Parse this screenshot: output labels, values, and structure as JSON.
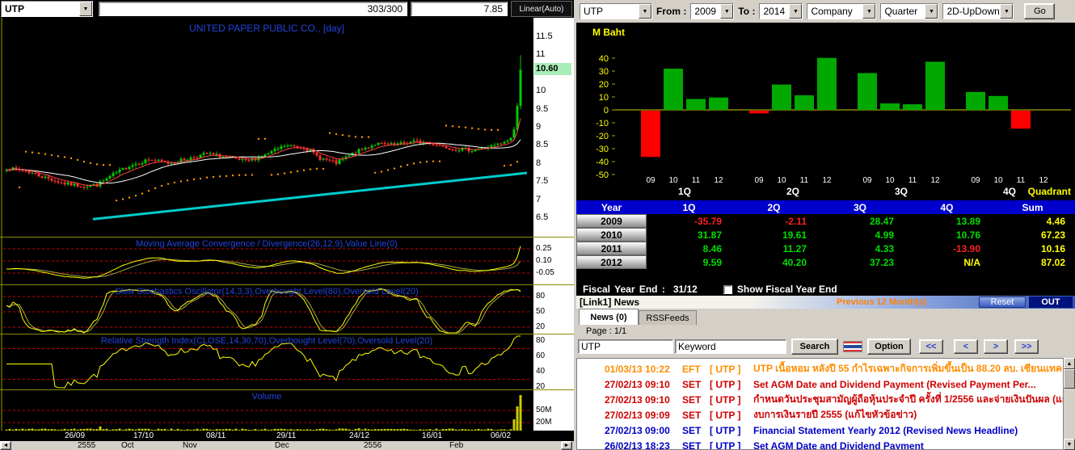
{
  "left": {
    "toolbar": {
      "symbol": "UTP",
      "range_field": "303/300",
      "price_field": "7.85",
      "scale_button": "Linear(Auto)"
    },
    "chart": {
      "title": "UNITED PAPER PUBLIC CO., [day]",
      "last_price": "10.60",
      "price_axis": [
        "11.5",
        "11",
        "10",
        "9.5",
        "9",
        "8.5",
        "8",
        "7.5",
        "7",
        "6.5"
      ],
      "candle_count": 160,
      "price_anchors": [
        [
          0,
          7.88
        ],
        [
          6,
          7.8
        ],
        [
          12,
          7.62
        ],
        [
          18,
          7.45
        ],
        [
          24,
          7.38
        ],
        [
          28,
          7.42
        ],
        [
          33,
          7.7
        ],
        [
          38,
          7.95
        ],
        [
          44,
          8.12
        ],
        [
          50,
          8.02
        ],
        [
          56,
          8.14
        ],
        [
          62,
          8.28
        ],
        [
          68,
          8.18
        ],
        [
          74,
          8.06
        ],
        [
          80,
          8.24
        ],
        [
          86,
          8.5
        ],
        [
          92,
          8.46
        ],
        [
          97,
          8.16
        ],
        [
          102,
          8.02
        ],
        [
          108,
          8.32
        ],
        [
          114,
          8.55
        ],
        [
          120,
          8.52
        ],
        [
          126,
          8.62
        ],
        [
          132,
          8.55
        ],
        [
          138,
          8.42
        ],
        [
          144,
          8.38
        ],
        [
          150,
          8.48
        ],
        [
          154,
          8.58
        ],
        [
          156,
          8.72
        ],
        [
          157,
          8.95
        ],
        [
          158,
          9.6
        ],
        [
          159,
          10.6
        ]
      ],
      "colors": {
        "up": "#00CC00",
        "down": "#FF3030",
        "ma_fast": "#FF4444",
        "ma_slow": "#FFFFFF",
        "trend": "#00CCCC",
        "sar": "#FF9900",
        "indicator": "#FFFF00",
        "indicator2": "#AAAA44",
        "level": "#CC0000",
        "volume": "#CCCC00",
        "frame": "#A0A000"
      },
      "macd": {
        "title": "Moving Average Convergence / Divergence(26,12,9),Value Line(0)",
        "axis": [
          "0.25",
          "0.10",
          "-0.05"
        ]
      },
      "stoch": {
        "title": "Slow Stochastics Oscillator(14,3,3),Overbought Level(80),Oversold Level(20)",
        "axis": [
          "80",
          "50",
          "20"
        ]
      },
      "rsi": {
        "title": "Relative Strength Index(CLOSE,14,30,70),Overbought Level(70),Oversold Level(20)",
        "axis": [
          "80",
          "60",
          "40",
          "20"
        ]
      },
      "volume": {
        "title": "Volume",
        "axis": [
          "50M",
          "20M"
        ]
      },
      "date_axis": [
        "26/09",
        "17/10",
        "08/11",
        "29/11",
        "24/12",
        "16/01",
        "06/02"
      ],
      "bottom_labels": [
        "2555",
        "Oct",
        "Nov",
        "Dec",
        "2556",
        "Feb"
      ]
    }
  },
  "right": {
    "toolbar": {
      "symbol": "UTP",
      "from_label": "From :",
      "from_value": "2009",
      "to_label": "To :",
      "to_value": "2014",
      "view_value": "Company",
      "period_value": "Quarter",
      "style_value": "2D-UpDown",
      "go_label": "Go"
    },
    "chart_data": {
      "type": "bar",
      "title": "M Baht",
      "groups": [
        "1Q",
        "2Q",
        "3Q",
        "4Q"
      ],
      "years": [
        "09",
        "10",
        "11",
        "12"
      ],
      "series": [
        {
          "group": "1Q",
          "values": [
            -35.79,
            31.87,
            8.46,
            9.59
          ]
        },
        {
          "group": "2Q",
          "values": [
            -2.11,
            19.61,
            11.27,
            40.2
          ]
        },
        {
          "group": "3Q",
          "values": [
            28.47,
            4.99,
            4.33,
            37.23
          ]
        },
        {
          "group": "4Q",
          "values": [
            13.89,
            10.76,
            -13.9,
            null
          ]
        }
      ],
      "ylim": [
        -50,
        40
      ],
      "yticks": [
        40,
        30,
        20,
        10,
        0,
        -10,
        -20,
        -30,
        -40,
        -50
      ],
      "positive_color": "#00A800",
      "negative_color": "#FF0000",
      "corner_label": "Quadrant"
    },
    "table": {
      "headers": [
        "Year",
        "1Q",
        "2Q",
        "3Q",
        "4Q",
        "Sum"
      ],
      "rows": [
        {
          "year": "2009",
          "values": [
            "-35.79",
            "-2.11",
            "28.47",
            "13.89",
            "4.46"
          ]
        },
        {
          "year": "2010",
          "values": [
            "31.87",
            "19.61",
            "4.99",
            "10.76",
            "67.23"
          ]
        },
        {
          "year": "2011",
          "values": [
            "8.46",
            "11.27",
            "4.33",
            "-13.90",
            "10.16"
          ]
        },
        {
          "year": "2012",
          "values": [
            "9.59",
            "40.20",
            "37.23",
            "N/A",
            "87.02"
          ]
        }
      ],
      "colors": {
        "positive": "#00DD00",
        "negative": "#FF2020",
        "sum": "#FFFF00"
      }
    },
    "fiscal": {
      "label": "Fiscal  Year  End  :",
      "value": "31/12",
      "checkbox_label": "Show Fiscal Year End"
    },
    "news": {
      "link_title": "[Link1] News",
      "previous_label": "Previous 12 Month(s)",
      "reset_label": "Reset",
      "out_label": "OUT",
      "tab_news": "News (0)",
      "tab_rss": "RSSFeeds",
      "page_label": "Page : 1/1",
      "symbol_value": "UTP",
      "keyword_value": "Keyword",
      "search_label": "Search",
      "option_label": "Option",
      "nav": [
        "<<",
        "<",
        ">",
        ">>"
      ],
      "items": [
        {
          "date": "01/03/13 10:22",
          "src": "EFT",
          "sym": "[ UTP ]",
          "text": "UTP เนื้อหอม หลังปี 55 กำไรเฉพาะกิจการเพิ่มขึ้นเป็น 88.20 ลบ. เซียนแทคเติบ...",
          "color": "#FF8C00"
        },
        {
          "date": "27/02/13 09:10",
          "src": "SET",
          "sym": "[ UTP ]",
          "text": "Set AGM Date and Dividend Payment (Revised Payment Per...",
          "color": "#D00000"
        },
        {
          "date": "27/02/13 09:10",
          "src": "SET",
          "sym": "[ UTP ]",
          "text": "กำหนดวันประชุมสามัญผู้ถือหุ้นประจำปี ครั้งที่ 1/2556 และจ่ายเงินปันผล (แก้ไข...",
          "color": "#D00000"
        },
        {
          "date": "27/02/13 09:09",
          "src": "SET",
          "sym": "[ UTP ]",
          "text": "งบการเงินรายปี 2555 (แก้ไขหัวข้อข่าว)",
          "color": "#D00000"
        },
        {
          "date": "27/02/13 09:00",
          "src": "SET",
          "sym": "[ UTP ]",
          "text": "Financial Statement Yearly 2012 (Revised News Headline)",
          "color": "#0000C8"
        },
        {
          "date": "26/02/13 18:23",
          "src": "SET",
          "sym": "[ UTP ]",
          "text": "Set AGM Date and Dividend Payment",
          "color": "#0000C8"
        }
      ]
    }
  }
}
